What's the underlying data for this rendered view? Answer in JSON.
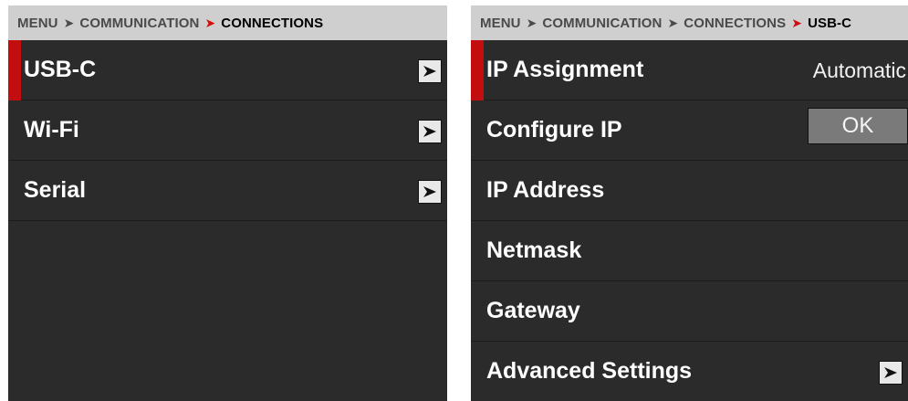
{
  "left_panel": {
    "breadcrumb": [
      "MENU",
      "COMMUNICATION",
      "CONNECTIONS"
    ],
    "items": [
      {
        "label": "USB-C",
        "selected": true,
        "control": "arrow"
      },
      {
        "label": "Wi-Fi",
        "selected": false,
        "control": "arrow"
      },
      {
        "label": "Serial",
        "selected": false,
        "control": "arrow"
      }
    ]
  },
  "right_panel": {
    "breadcrumb": [
      "MENU",
      "COMMUNICATION",
      "CONNECTIONS",
      "USB-C"
    ],
    "items": [
      {
        "label": "IP Assignment",
        "selected": true,
        "value": "Automatic"
      },
      {
        "label": "Configure IP",
        "button": "OK"
      },
      {
        "label": "IP Address"
      },
      {
        "label": "Netmask"
      },
      {
        "label": "Gateway"
      },
      {
        "label": "Advanced Settings",
        "control": "arrow"
      }
    ]
  },
  "icons": {
    "separator": "chevron-right-icon",
    "row_arrow": "arrow-right-icon"
  },
  "colors": {
    "accent": "#c20e0e",
    "breadcrumb_bg": "#cfcfcf",
    "panel_bg": "#2b2b2b"
  }
}
